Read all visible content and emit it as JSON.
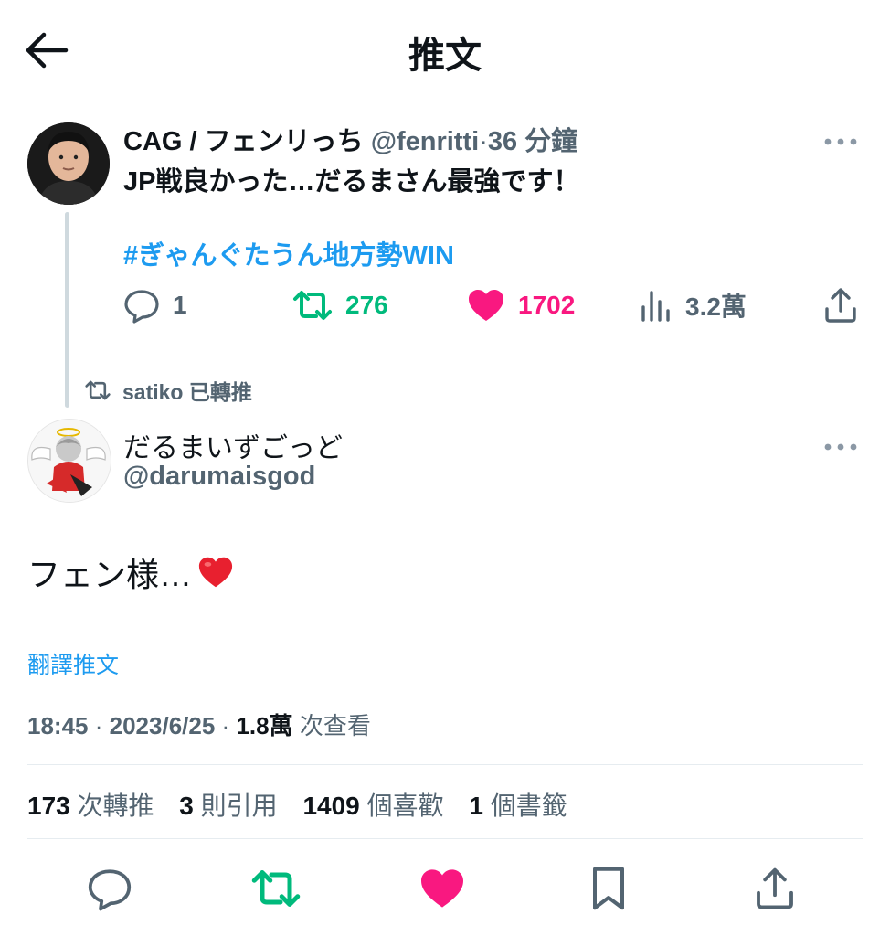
{
  "header": {
    "title": "推文"
  },
  "parent_tweet": {
    "display_name": "CAG / フェンリっち",
    "handle": "@fenritti",
    "separator": "·",
    "time_ago": "36 分鐘",
    "text": "JP戦良かった…だるまさん最強です！",
    "hashtag": "#ぎゃんぐたうん地方勢WIN",
    "replies": "1",
    "retweets": "276",
    "likes": "1702",
    "views": "3.2萬"
  },
  "retweet_context": {
    "text": "satiko 已轉推"
  },
  "main_tweet": {
    "display_name": "だるまいずごっど",
    "handle": "@darumaisgod",
    "text": "フェン様…",
    "translate_label": "翻譯推文",
    "time": "18:45",
    "date": "2023/6/25",
    "views_count": "1.8萬",
    "views_label": "次查看",
    "separator": "·"
  },
  "stats": {
    "retweets_num": "173",
    "retweets_label": "次轉推",
    "quotes_num": "3",
    "quotes_label": "則引用",
    "likes_num": "1409",
    "likes_label": "個喜歡",
    "bookmarks_num": "1",
    "bookmarks_label": "個書籤"
  },
  "colors": {
    "retweet_green": "#00ba7c",
    "like_pink": "#f91880",
    "link_blue": "#1d9bf0",
    "muted_gray": "#536471"
  },
  "icons": [
    "back-arrow-icon",
    "more-icon",
    "reply-icon",
    "retweet-icon",
    "heart-icon",
    "views-icon",
    "share-icon",
    "bookmark-icon",
    "red-heart-emoji-icon"
  ]
}
